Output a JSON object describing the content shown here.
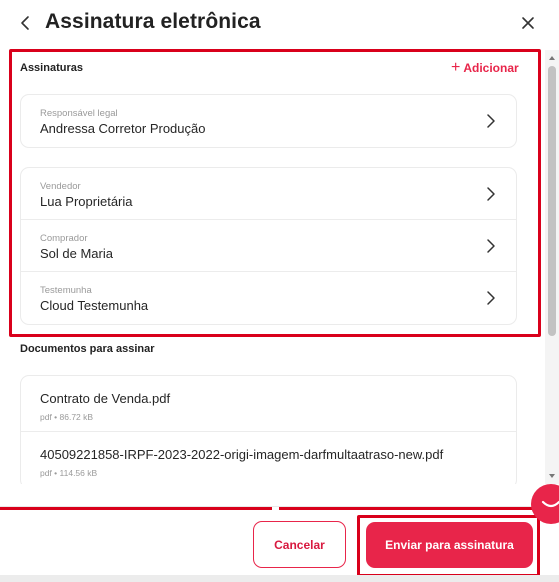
{
  "header": {
    "title": "Assinatura eletrônica",
    "back_icon": "chevron-left-icon",
    "close_icon": "close-icon"
  },
  "signatures": {
    "section_title": "Assinaturas",
    "add_label": "Adicionar",
    "legal_card": [
      {
        "label": "Responsável legal",
        "value": "Andressa Corretor Produção"
      }
    ],
    "parties_card": [
      {
        "label": "Vendedor",
        "value": "Lua Proprietária"
      },
      {
        "label": "Comprador",
        "value": "Sol de Maria"
      },
      {
        "label": "Testemunha",
        "value": "Cloud Testemunha"
      }
    ]
  },
  "documents": {
    "section_title": "Documentos para assinar",
    "items": [
      {
        "name": "Contrato de Venda.pdf",
        "meta": "pdf • 86.72 kB"
      },
      {
        "name": "40509221858-IRPF-2023-2022-origi-imagem-darfmultaatraso-new.pdf",
        "meta": "pdf • 114.56 kB"
      }
    ]
  },
  "footer": {
    "cancel_label": "Cancelar",
    "send_label": "Enviar para assinatura"
  },
  "colors": {
    "accent": "#e8254a",
    "highlight": "#d9001b"
  }
}
